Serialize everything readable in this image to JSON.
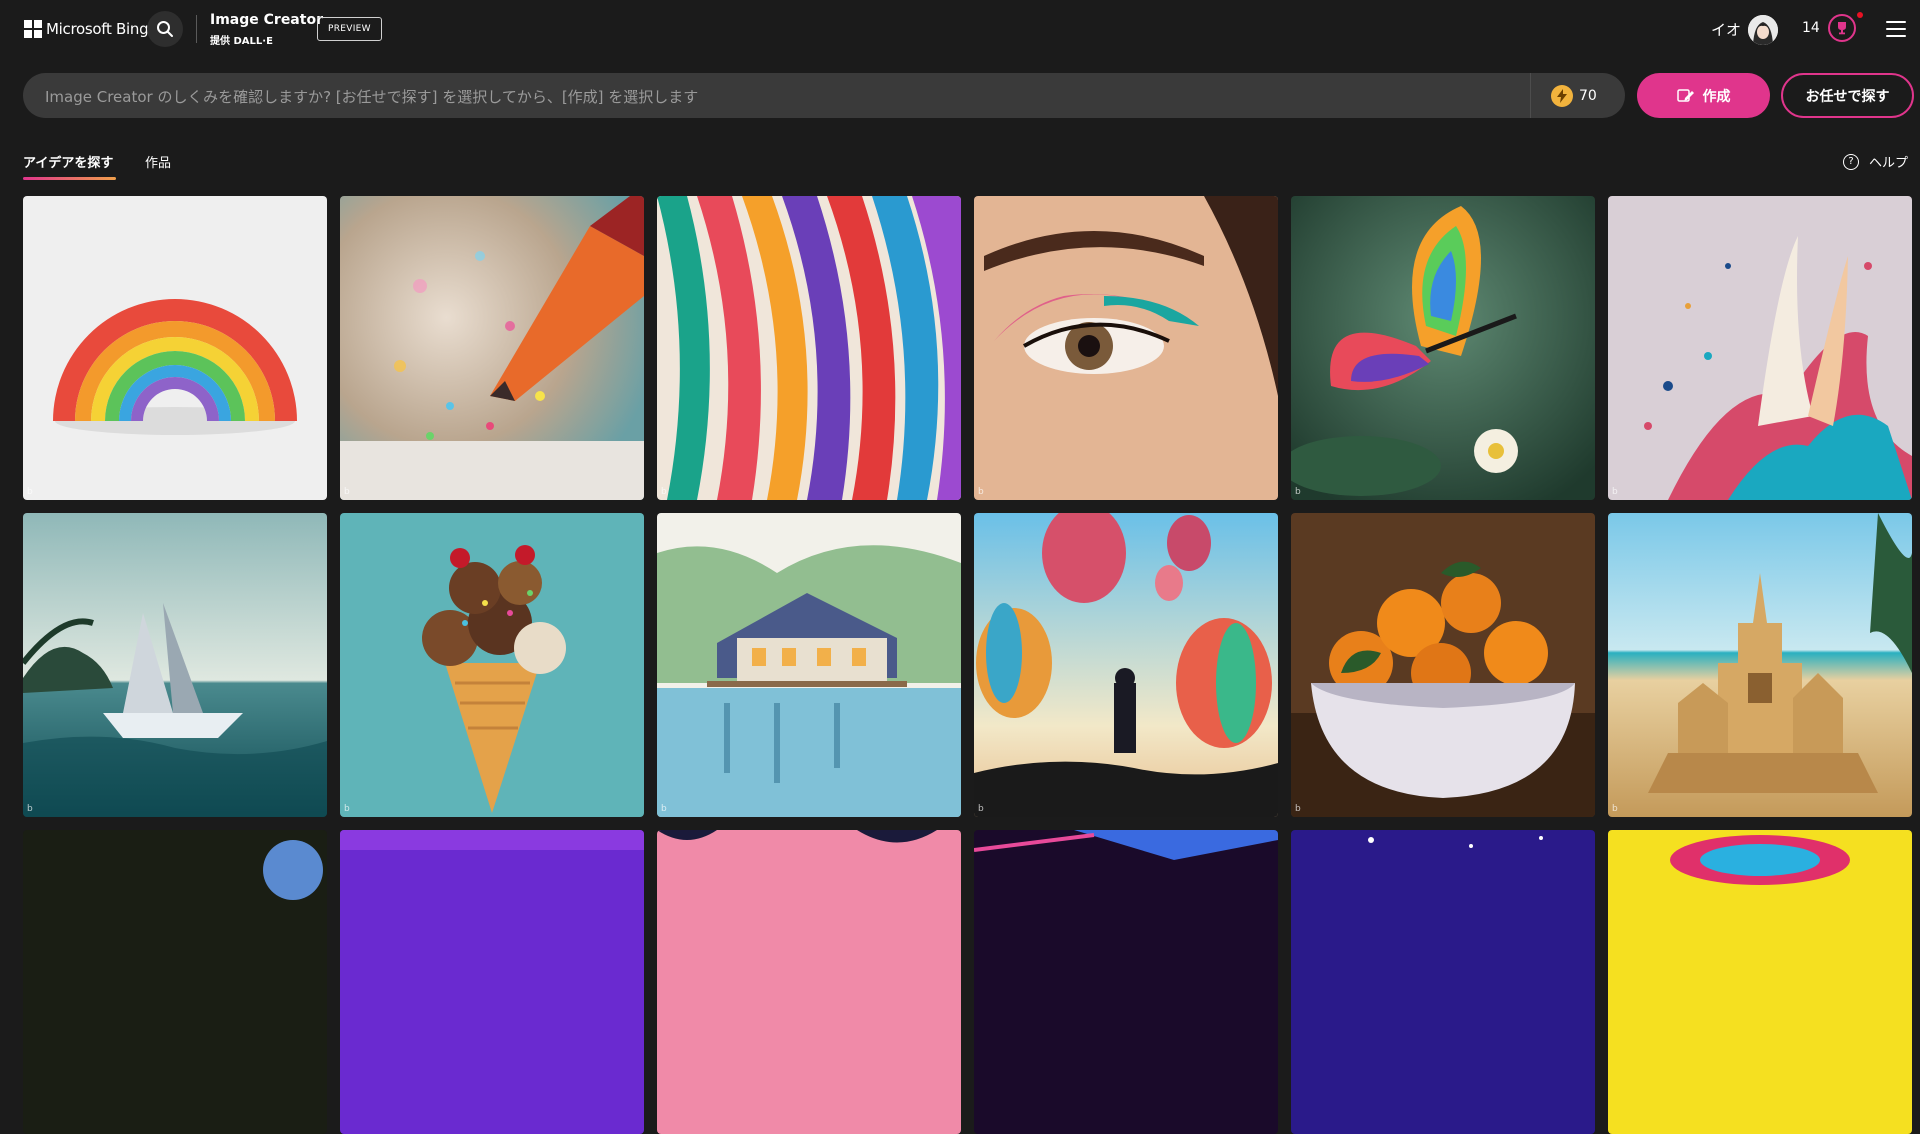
{
  "header": {
    "brand": "Microsoft Bing",
    "app_title": "Image Creator",
    "app_subtitle": "提供 DALL·E",
    "preview_label": "PREVIEW",
    "user_name": "イオ",
    "reward_count": "14"
  },
  "prompt": {
    "placeholder": "Image Creator のしくみを確認しますか? [お任せで探す] を選択してから、[作成] を選択します",
    "boost_count": "70",
    "create_label": "作成",
    "surprise_label": "お任せで探す"
  },
  "tabs": {
    "explore": "アイデアを探す",
    "creations": "作品",
    "help": "ヘルプ"
  },
  "colors": {
    "background": "#1b1b1b",
    "accent": "#e0358c",
    "prompt_bg": "#3a3a3a",
    "boost": "#f2b33d"
  },
  "watermark": "b",
  "gallery": [
    {
      "icon": "rainbow-image"
    },
    {
      "icon": "glitter-pencil-image"
    },
    {
      "icon": "ribbons-image"
    },
    {
      "icon": "eye-makeup-image"
    },
    {
      "icon": "butterfly-image"
    },
    {
      "icon": "paint-splash-image"
    },
    {
      "icon": "paper-boat-image"
    },
    {
      "icon": "ice-cream-image"
    },
    {
      "icon": "lake-house-image"
    },
    {
      "icon": "balloons-image"
    },
    {
      "icon": "oranges-bowl-image"
    },
    {
      "icon": "sandcastle-image"
    }
  ]
}
